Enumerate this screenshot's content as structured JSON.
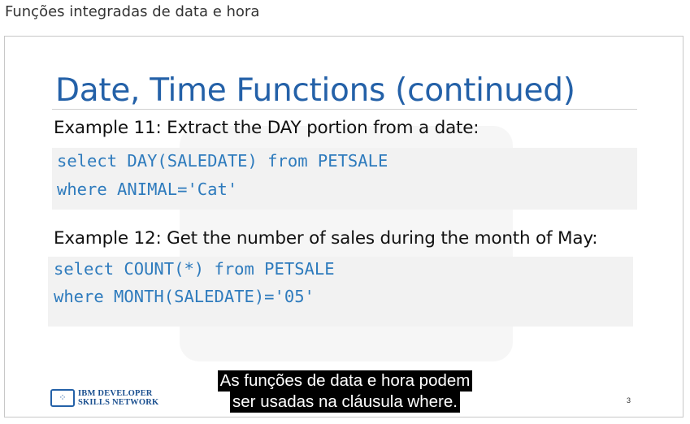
{
  "page": {
    "heading": "Funções integradas de data e hora"
  },
  "slide": {
    "title": "Date, Time Functions (continued)",
    "example11": {
      "heading": "Example 11: Extract the DAY portion from a date:",
      "code": [
        "select DAY(SALEDATE) from PETSALE",
        "where ANIMAL='Cat'"
      ]
    },
    "example12": {
      "heading": "Example 12: Get the number of sales during the month of May:",
      "code": [
        "select COUNT(*) from PETSALE",
        "where MONTH(SALEDATE)='05'"
      ]
    },
    "logo": {
      "line1": "IBM DEVELOPER",
      "line2": "SKILLS NETWORK",
      "icon": "ibm-skills-network-logo-icon"
    },
    "slide_number": "3"
  },
  "caption": {
    "lines": [
      "As funções de data e hora podem",
      "ser usadas na cláusula where."
    ]
  },
  "colors": {
    "title": "#2461a8",
    "code_text": "#2e7bbd",
    "code_background": "#f2f2f2",
    "caption_background": "#000000",
    "caption_text": "#ffffff"
  }
}
